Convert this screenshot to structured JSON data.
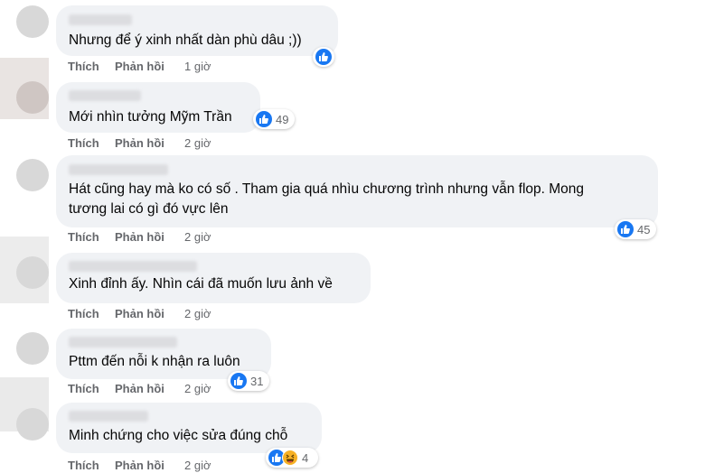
{
  "comments": [
    {
      "text": "Nhưng để ý xinh nhất dàn phù dâu ;))",
      "like": "Thích",
      "reply": "Phản hồi",
      "time": "1 giờ",
      "count": ""
    },
    {
      "text": "Mới nhìn tưởng Mỹm Trần",
      "like": "Thích",
      "reply": "Phản hồi",
      "time": "2 giờ",
      "count": "49"
    },
    {
      "text": "Hát cũng hay mà ko có số . Tham gia quá nhìu chương trình nhưng vẫn flop. Mong",
      "text2": "tương lai có gì đó vực lên",
      "like": "Thích",
      "reply": "Phản hồi",
      "time": "2 giờ",
      "count": "45"
    },
    {
      "text": "Xinh đỉnh ấy. Nhìn cái đã muốn lưu ảnh về",
      "like": "Thích",
      "reply": "Phản hồi",
      "time": "2 giờ",
      "count": ""
    },
    {
      "text": "Pttm đến nỗi k nhận ra luôn",
      "like": "Thích",
      "reply": "Phản hồi",
      "time": "2 giờ",
      "count": "31"
    },
    {
      "text": "Minh chứng cho việc sửa đúng chỗ",
      "like": "Thích",
      "reply": "Phản hồi",
      "time": "2 giờ",
      "count": "4"
    }
  ],
  "colors": {
    "bubble": "#f0f2f5",
    "like_blue": "#1877f2",
    "meta_gray": "#65676b"
  },
  "icons": [
    "like-icon",
    "haha-icon"
  ]
}
